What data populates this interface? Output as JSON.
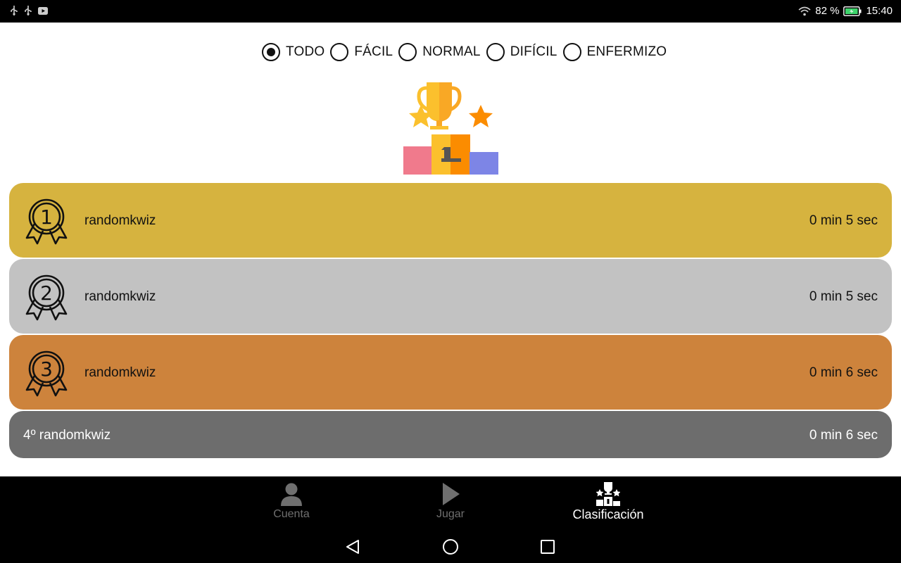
{
  "status_bar": {
    "battery_percent": "82 %",
    "time": "15:40",
    "icons": [
      "usb-icon",
      "usb-icon",
      "youtube-icon",
      "wifi-icon",
      "battery-charging-icon"
    ]
  },
  "difficulty": {
    "options": [
      {
        "label": "TODO",
        "selected": true
      },
      {
        "label": "FÁCIL",
        "selected": false
      },
      {
        "label": "NORMAL",
        "selected": false
      },
      {
        "label": "DIFÍCIL",
        "selected": false
      },
      {
        "label": "ENFERMIZO",
        "selected": false
      }
    ]
  },
  "header_icon": "podium-trophy-icon",
  "ranking": [
    {
      "position": "1",
      "player": "randomkwiz",
      "time": "0 min 5 sec",
      "color": "#d6b33f"
    },
    {
      "position": "2",
      "player": "randomkwiz",
      "time": "0 min 5 sec",
      "color": "#c2c2c2"
    },
    {
      "position": "3",
      "player": "randomkwiz",
      "time": "0 min 6 sec",
      "color": "#cd833c"
    },
    {
      "label": "4º randomkwiz",
      "time": "0 min 6 sec",
      "color": "#6d6d6d"
    }
  ],
  "bottom_nav": {
    "items": [
      {
        "label": "Cuenta",
        "icon": "person-icon",
        "active": false
      },
      {
        "label": "Jugar",
        "icon": "play-icon",
        "active": false
      },
      {
        "label": "Clasificación",
        "icon": "podium-icon",
        "active": true
      }
    ]
  },
  "system_nav": [
    "back-icon",
    "home-icon",
    "recents-icon"
  ]
}
